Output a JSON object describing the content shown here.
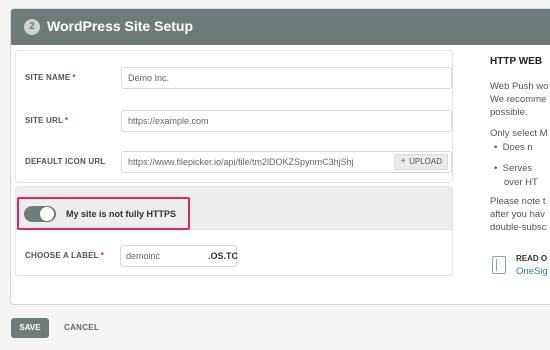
{
  "header": {
    "step": "2",
    "title": "WordPress Site Setup"
  },
  "fields": {
    "site_name": {
      "label": "SITE NAME",
      "value": "Demo Inc."
    },
    "site_url": {
      "label": "SITE URL",
      "value": "https://example.com"
    },
    "default_icon_url": {
      "label": "DEFAULT ICON URL",
      "value": "https://www.filepicker.io/api/file/tm2lDOKZSpynmC3hjShj",
      "upload_label": "UPLOAD"
    },
    "label": {
      "label": "CHOOSE A LABEL",
      "value": "demoinc",
      "suffix": ".OS.TC"
    }
  },
  "https_toggle": {
    "label": "My site is not fully HTTPS",
    "state": "on"
  },
  "sidebar": {
    "title": "HTTP WEB",
    "lines": [
      "Web Push wo",
      "We recomme",
      "possible.",
      "Only select M"
    ],
    "bullets": [
      "Does n",
      "Serves",
      "over HT"
    ],
    "note": [
      "Please note t",
      "after you hav",
      "double-subsc"
    ],
    "read_more": [
      "READ O",
      "OneSig"
    ]
  },
  "footer": {
    "save_label": "SAVE",
    "cancel_label": "CANCEL"
  },
  "colors": {
    "header_bg": "#6f7a7a",
    "highlight": "#e0246a",
    "required": "#e0245e"
  }
}
